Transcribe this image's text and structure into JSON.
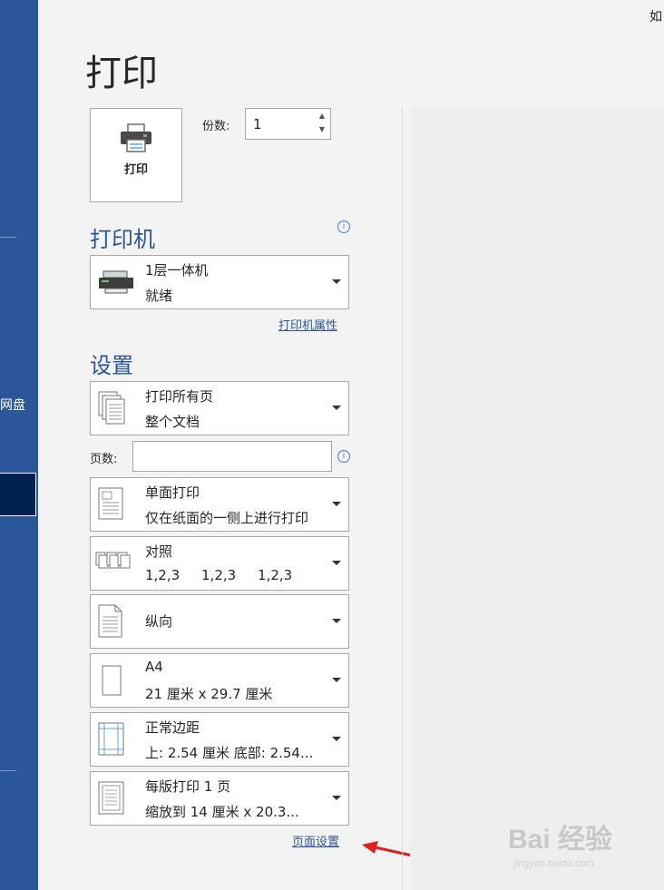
{
  "sidebar": {
    "partial_label": "网盘"
  },
  "corner_text": "如",
  "title": "打印",
  "print_button": {
    "label": "打印"
  },
  "copies": {
    "label": "份数:",
    "value": "1"
  },
  "printer_section": {
    "heading": "打印机",
    "printer": {
      "name": "1层一体机",
      "status": "就绪"
    },
    "properties_link": "打印机属性"
  },
  "settings_section": {
    "heading": "设置",
    "range": {
      "line1": "打印所有页",
      "line2": "整个文档"
    },
    "pages_label": "页数:",
    "pages_value": "",
    "sides": {
      "line1": "单面打印",
      "line2": "仅在纸面的一侧上进行打印"
    },
    "collate": {
      "line1": "对照",
      "line2": "1,2,3     1,2,3     1,2,3"
    },
    "orientation": {
      "line1": "纵向"
    },
    "paper": {
      "line1": "A4",
      "line2": "21 厘米 x 29.7 厘米"
    },
    "margins": {
      "line1": "正常边距",
      "line2": "上: 2.54 厘米 底部: 2.54..."
    },
    "per_sheet": {
      "line1": "每版打印 1 页",
      "line2": "缩放到 14 厘米 x 20.3..."
    },
    "page_setup_link": "页面设置"
  },
  "watermark": {
    "brand": "Bai 经验",
    "url": "jingyan.baidu.com"
  },
  "colors": {
    "sidebar": "#2b579a",
    "accent": "#2b579a",
    "arrow": "#e02020"
  }
}
